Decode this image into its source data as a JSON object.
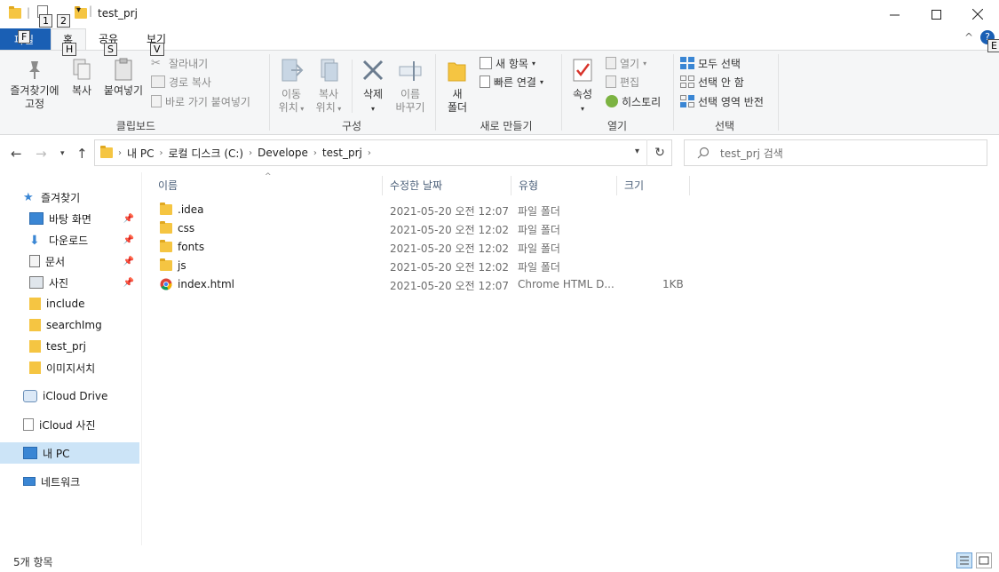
{
  "window": {
    "title": "test_prj",
    "keytips": {
      "one": "1",
      "two": "2",
      "file": "F",
      "home": "H",
      "share": "S",
      "view": "V",
      "help": "E"
    }
  },
  "ribbon_tabs": {
    "file": "파일",
    "home": "홈",
    "share": "공유",
    "view": "보기"
  },
  "ribbon": {
    "clipboard": {
      "label": "클립보드",
      "pin": "즐겨찾기에",
      "pin2": "고정",
      "copy": "복사",
      "paste": "붙여넣기",
      "cut": "잘라내기",
      "copy_path": "경로 복사",
      "paste_shortcut": "바로 가기 붙여넣기"
    },
    "organize": {
      "label": "구성",
      "move_to": "이동",
      "move_to2": "위치",
      "copy_to": "복사",
      "copy_to2": "위치",
      "delete": "삭제",
      "rename": "이름",
      "rename2": "바꾸기"
    },
    "new": {
      "label": "새로 만들기",
      "new_folder": "새",
      "new_folder2": "폴더",
      "new_item": "새 항목",
      "easy_access": "빠른 연결"
    },
    "open": {
      "label": "열기",
      "properties": "속성",
      "open": "열기",
      "edit": "편집",
      "history": "히스토리"
    },
    "select": {
      "label": "선택",
      "select_all": "모두 선택",
      "select_none": "선택 안 함",
      "invert": "선택 영역 반전"
    }
  },
  "address": {
    "crumbs": [
      "내 PC",
      "로컬 디스크 (C:)",
      "Develope",
      "test_prj"
    ],
    "search_placeholder": "test_prj 검색"
  },
  "sidebar": {
    "items": [
      {
        "label": "즐겨찾기"
      },
      {
        "label": "바탕 화면"
      },
      {
        "label": "다운로드"
      },
      {
        "label": "문서"
      },
      {
        "label": "사진"
      },
      {
        "label": "include"
      },
      {
        "label": "searchImg"
      },
      {
        "label": "test_prj"
      },
      {
        "label": "이미지서치"
      },
      {
        "label": "iCloud Drive"
      },
      {
        "label": "iCloud 사진"
      },
      {
        "label": "내 PC"
      },
      {
        "label": "네트워크"
      }
    ]
  },
  "columns": {
    "name": "이름",
    "date": "수정한 날짜",
    "type": "유형",
    "size": "크기"
  },
  "files": [
    {
      "name": ".idea",
      "date": "2021-05-20 오전 12:07",
      "type": "파일 폴더",
      "size": ""
    },
    {
      "name": "css",
      "date": "2021-05-20 오전 12:02",
      "type": "파일 폴더",
      "size": ""
    },
    {
      "name": "fonts",
      "date": "2021-05-20 오전 12:02",
      "type": "파일 폴더",
      "size": ""
    },
    {
      "name": "js",
      "date": "2021-05-20 오전 12:02",
      "type": "파일 폴더",
      "size": ""
    },
    {
      "name": "index.html",
      "date": "2021-05-20 오전 12:07",
      "type": "Chrome HTML D...",
      "size": "1KB"
    }
  ],
  "status": {
    "item_count": "5개 항목"
  },
  "colors": {
    "accent": "#1a5fb4",
    "folder": "#f5c542",
    "selected": "#cce4f7"
  }
}
